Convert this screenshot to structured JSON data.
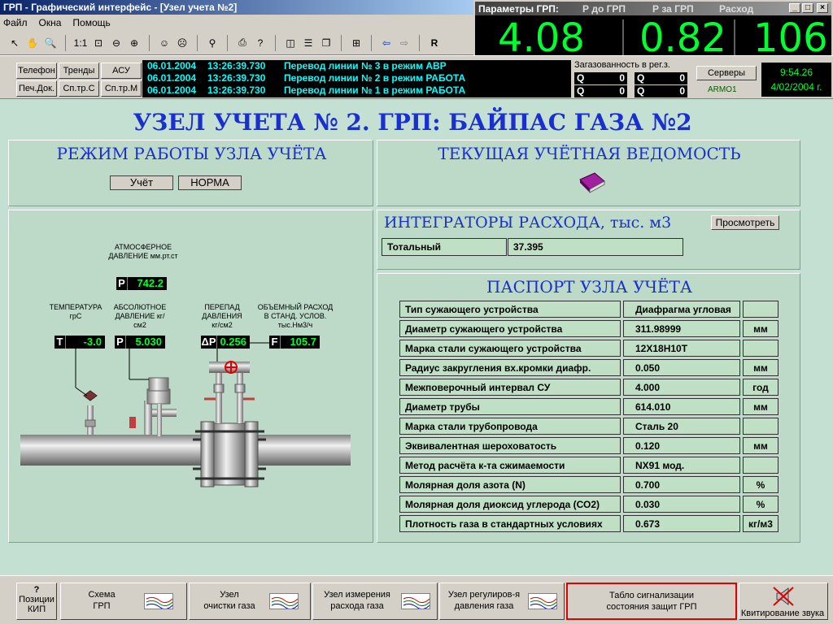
{
  "app": {
    "title": "ГРП - Графический интерфейс - [Узел учета №2]",
    "menu": [
      "Файл",
      "Окна",
      "Помощь"
    ]
  },
  "params_window": {
    "title": "Параметры ГРП:",
    "headers": [
      "Р до ГРП",
      "Р за ГРП",
      "Расход"
    ],
    "values": [
      "4.08",
      "0.82",
      "106"
    ],
    "value_color": "#00ff30"
  },
  "nav_buttons": [
    "Телефон",
    "Тренды",
    "АСУ",
    "Печ.Док.",
    "Сп.тр.С",
    "Сп.тр.М"
  ],
  "events": [
    {
      "date": "06.01.2004",
      "time": "13:26:39.730",
      "text": "Перевод линии № 3 в режим АВР"
    },
    {
      "date": "06.01.2004",
      "time": "13:26:39.730",
      "text": "Перевод линии № 2 в режим РАБОТА"
    },
    {
      "date": "06.01.2004",
      "time": "13:26:39.730",
      "text": "Перевод линии № 1 в режим РАБОТА"
    }
  ],
  "gas_contamination": {
    "label": "Загазованность в рег.з.",
    "cells": [
      {
        "q": "Q",
        "v": "0"
      },
      {
        "q": "Q",
        "v": "0"
      },
      {
        "q": "Q",
        "v": "0"
      },
      {
        "q": "Q",
        "v": "0"
      }
    ]
  },
  "servers": {
    "button": "Серверы",
    "station": "ARMO1"
  },
  "clock": {
    "time": "9:54.26",
    "date": "4/02/2004 г."
  },
  "page_title": "УЗЕЛ УЧЕТА № 2. ГРП: БАЙПАС ГАЗА №2",
  "mode_panel": {
    "title": "РЕЖИМ РАБОТЫ УЗЛА УЧЁТА",
    "mode": "Учёт",
    "state": "НОРМА"
  },
  "report_panel": {
    "title": "ТЕКУЩАЯ УЧЁТНАЯ  ВЕДОМОСТЬ",
    "icon": "book-icon"
  },
  "integrators": {
    "title": "ИНТЕГРАТОРЫ РАСХОДА, тыс. м3",
    "view_button": "Просмотреть",
    "label": "Тотальный",
    "value": "37.395"
  },
  "sensors": {
    "atm": {
      "label": "АТМОСФЕРНОЕ ДАВЛЕНИЕ мм.рт.ст",
      "tag": "P",
      "value": "742.2"
    },
    "temp": {
      "label": "ТЕМПЕРАТУРА грС",
      "tag": "T",
      "value": "-3.0"
    },
    "abs": {
      "label": "АБСОЛЮТНОЕ ДАВЛЕНИЕ кг/см2",
      "tag": "P",
      "value": "5.030"
    },
    "dp": {
      "label": "ПЕРЕПАД ДАВЛЕНИЯ кг/см2",
      "tag": "ΔP",
      "value": "0.256"
    },
    "flow": {
      "label": "ОБЪЕМНЫЙ РАСХОД В СТАНД. УСЛОВ. тыс.Нм3/ч",
      "tag": "F",
      "value": "105.7"
    }
  },
  "passport": {
    "title": "ПАСПОРТ УЗЛА УЧЁТА",
    "rows": [
      {
        "name": "Тип сужающего устройства",
        "value": "Диафрагма угловая",
        "unit": ""
      },
      {
        "name": "Диаметр сужающего устройства",
        "value": "311.98999",
        "unit": "мм"
      },
      {
        "name": "Марка стали сужающего устройства",
        "value": "12Х18Н10Т",
        "unit": ""
      },
      {
        "name": "Радиус закругления вх.кромки диафр.",
        "value": "0.050",
        "unit": "мм"
      },
      {
        "name": "Межповерочный интервал СУ",
        "value": "4.000",
        "unit": "год"
      },
      {
        "name": "Диаметр трубы",
        "value": "614.010",
        "unit": "мм"
      },
      {
        "name": "Марка стали трубопровода",
        "value": "Сталь 20",
        "unit": ""
      },
      {
        "name": "Эквивалентная шероховатость",
        "value": "0.120",
        "unit": "мм"
      },
      {
        "name": "Метод расчёта к-та сжимаемости",
        "value": "NX91 мод.",
        "unit": ""
      },
      {
        "name": "Молярная доля азота (N)",
        "value": "0.700",
        "unit": "%"
      },
      {
        "name": "Молярная доля диоксид углерода (СО2)",
        "value": "0.030",
        "unit": "%"
      },
      {
        "name": "Плотность газа в стандартных условиях",
        "value": "0.673",
        "unit": "кг/м3"
      }
    ]
  },
  "bottom_buttons": [
    {
      "label1": "?",
      "label2": "Позиции",
      "label3": "КИП"
    },
    {
      "label1": "Схема",
      "label2": "ГРП"
    },
    {
      "label1": "Узел",
      "label2": "очистки газа"
    },
    {
      "label1": "Узел измерения",
      "label2": "расхода газа"
    },
    {
      "label1": "Узел регулиров-я",
      "label2": "давления газа"
    },
    {
      "label1": "Табло сигнализации",
      "label2": "состояния защит ГРП"
    },
    {
      "label1": "Квитирование звука"
    }
  ],
  "colors": {
    "accent_blue": "#1a2fd0",
    "panel_bg": "#bddac9",
    "alarm_red": "#e00000"
  }
}
